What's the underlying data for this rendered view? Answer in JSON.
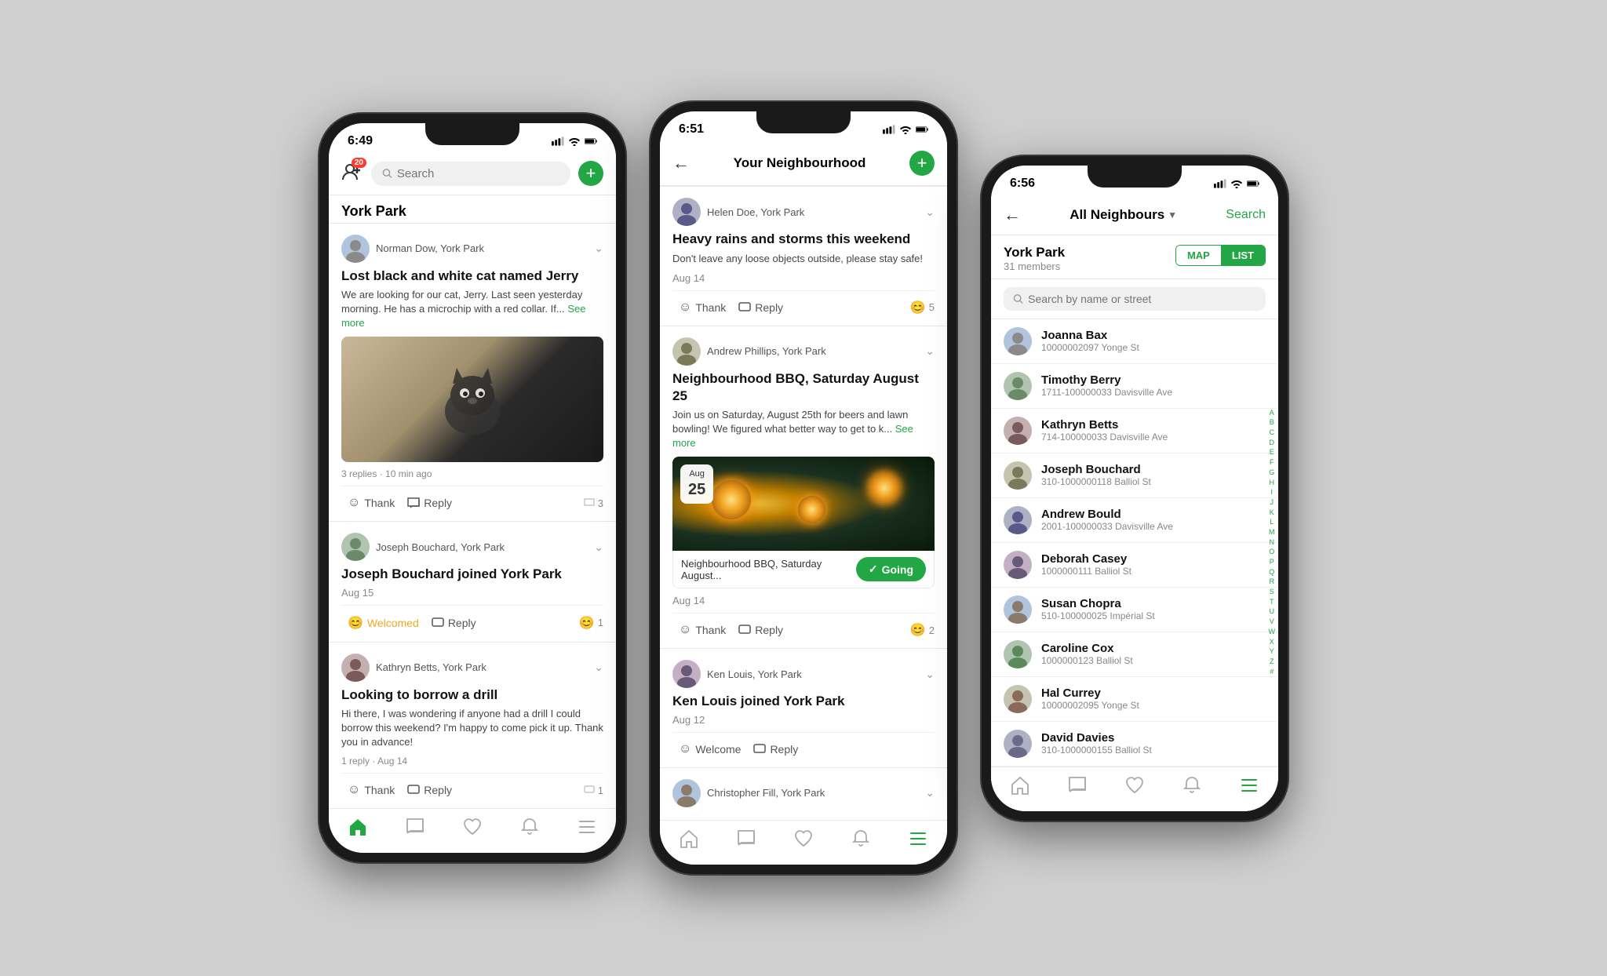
{
  "phones": [
    {
      "id": "phone1",
      "status": {
        "time": "6:49",
        "signal": true,
        "wifi": true,
        "battery": true
      },
      "header": {
        "notification_count": "20",
        "search_placeholder": "Search",
        "plus_label": "+"
      },
      "neighbourhood": "York Park",
      "posts": [
        {
          "id": "post1",
          "author": "Norman Dow, York Park",
          "title": "Lost black and white cat named Jerry",
          "body": "We are looking for our cat, Jerry. Last seen yesterday morning. He has a microchip with a red collar. If...",
          "see_more": "See more",
          "has_image": true,
          "meta": "3 replies · 10 min ago",
          "actions": {
            "thank_label": "Thank",
            "reply_label": "Reply",
            "count": "3",
            "thank_type": "neutral"
          }
        },
        {
          "id": "post2",
          "author": "Joseph Bouchard, York Park",
          "title": "Joseph Bouchard joined York Park",
          "body": "",
          "date": "Aug 15",
          "actions": {
            "thank_label": "Welcomed",
            "reply_label": "Reply",
            "count": "1",
            "thank_type": "welcomed"
          }
        },
        {
          "id": "post3",
          "author": "Kathryn Betts, York Park",
          "title": "Looking to borrow a drill",
          "body": "Hi there, I was wondering if anyone had a drill I could borrow this weekend? I'm happy to come pick it up. Thank you in advance!",
          "meta": "1 reply · Aug 14",
          "actions": {
            "thank_label": "Thank",
            "reply_label": "Reply",
            "count": "1",
            "thank_type": "neutral"
          }
        }
      ],
      "tabs": [
        {
          "id": "home",
          "label": "Home",
          "active": true
        },
        {
          "id": "messages",
          "label": "Messages",
          "active": false
        },
        {
          "id": "heart",
          "label": "Heart",
          "active": false
        },
        {
          "id": "bell",
          "label": "Bell",
          "active": false
        },
        {
          "id": "menu",
          "label": "Menu",
          "active": false
        }
      ]
    },
    {
      "id": "phone2",
      "status": {
        "time": "6:51",
        "signal": true,
        "wifi": true,
        "battery": true
      },
      "header": {
        "title": "Your Neighbourhood",
        "back_label": "←",
        "plus_label": "+"
      },
      "posts": [
        {
          "id": "p2-1",
          "author": "Helen Doe, York Park",
          "title": "Heavy rains and storms this weekend",
          "body": "Don't leave any loose objects outside, please stay safe!",
          "date": "Aug 14",
          "actions": {
            "thank_label": "Thank",
            "reply_label": "Reply",
            "count": "5",
            "thank_type": "neutral"
          }
        },
        {
          "id": "p2-2",
          "author": "Andrew Phillips, York Park",
          "title": "Neighbourhood BBQ, Saturday August 25",
          "body": "Join us on Saturday, August 25th for beers and lawn bowling! We figured what better way to get to k...",
          "see_more": "See more",
          "date": "Aug 14",
          "has_event": true,
          "event": {
            "month": "Aug",
            "day": "25",
            "title": "Neighbourhood BBQ, Saturday August...",
            "going_label": "Going",
            "going_check": "✓"
          },
          "actions": {
            "thank_label": "Thank",
            "reply_label": "Reply",
            "count": "2",
            "thank_type": "neutral"
          }
        },
        {
          "id": "p2-3",
          "author": "Ken Louis, York Park",
          "title": "Ken Louis joined York Park",
          "date": "Aug 12",
          "actions": {
            "thank_label": "Welcome",
            "reply_label": "Reply",
            "count": "",
            "thank_type": "neutral"
          }
        },
        {
          "id": "p2-4",
          "author": "Christopher Fill, York Park",
          "title": "",
          "truncated": true
        }
      ],
      "tabs": [
        {
          "id": "home",
          "label": "Home",
          "active": false
        },
        {
          "id": "messages",
          "label": "Messages",
          "active": false
        },
        {
          "id": "heart",
          "label": "Heart",
          "active": false
        },
        {
          "id": "bell",
          "label": "Bell",
          "active": false
        },
        {
          "id": "menu",
          "label": "Menu",
          "active": true
        }
      ]
    },
    {
      "id": "phone3",
      "status": {
        "time": "6:56",
        "signal": true,
        "wifi": true,
        "battery": true
      },
      "header": {
        "back_label": "←",
        "dropdown_title": "All Neighbours",
        "search_label": "Search"
      },
      "neighbourhood": {
        "name": "York Park",
        "members": "31 members"
      },
      "toggle": {
        "map_label": "MAP",
        "list_label": "LIST",
        "active": "LIST"
      },
      "search_placeholder": "Search by name or street",
      "neighbours": [
        {
          "name": "Joanna Bax",
          "address": "10000002097 Yonge St"
        },
        {
          "name": "Timothy Berry",
          "address": "1711-100000033 Davisville Ave"
        },
        {
          "name": "Kathryn Betts",
          "address": "714-100000033 Davisville Ave"
        },
        {
          "name": "Joseph Bouchard",
          "address": "310-1000000118 Balliol St"
        },
        {
          "name": "Andrew Bould",
          "address": "2001-100000033 Davisville Ave"
        },
        {
          "name": "Deborah Casey",
          "address": "1000000111 Balliol St"
        },
        {
          "name": "Susan Chopra",
          "address": "510-100000025 Impérial St"
        },
        {
          "name": "Caroline Cox",
          "address": "1000000123 Balliol St"
        },
        {
          "name": "Hal Currey",
          "address": "10000002095 Yonge St"
        },
        {
          "name": "David Davies",
          "address": "310-1000000155 Balliol St"
        }
      ],
      "alpha_index": [
        "A",
        "B",
        "C",
        "D",
        "E",
        "F",
        "G",
        "H",
        "I",
        "J",
        "K",
        "L",
        "M",
        "N",
        "O",
        "P",
        "Q",
        "R",
        "S",
        "T",
        "U",
        "V",
        "W",
        "X",
        "Y",
        "Z",
        "#"
      ],
      "tabs": [
        {
          "id": "home",
          "label": "Home",
          "active": false
        },
        {
          "id": "messages",
          "label": "Messages",
          "active": false
        },
        {
          "id": "heart",
          "label": "Heart",
          "active": false
        },
        {
          "id": "bell",
          "label": "Bell",
          "active": false
        },
        {
          "id": "menu",
          "label": "Menu",
          "active": true
        }
      ]
    }
  ]
}
